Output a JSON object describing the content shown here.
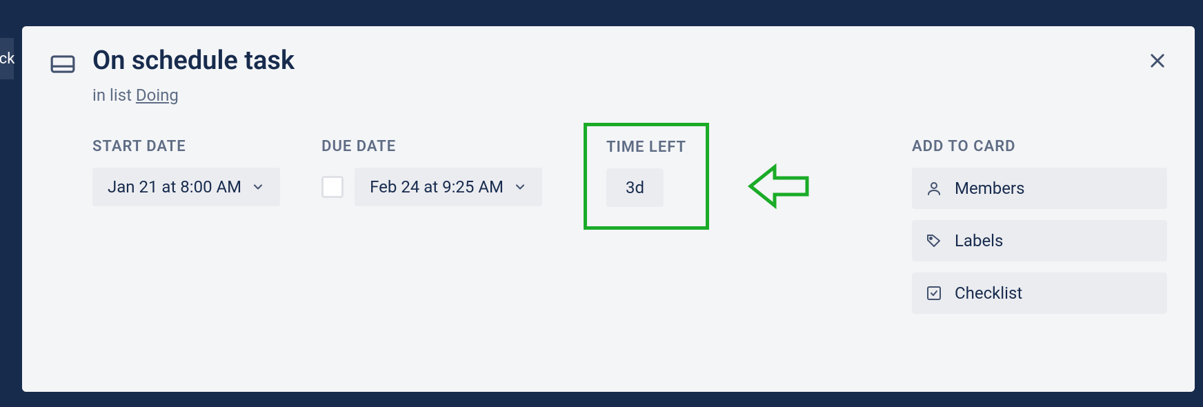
{
  "bg_hint": "ck",
  "card": {
    "title": "On schedule task",
    "subtitle_prefix": "in list ",
    "list_name": "Doing"
  },
  "fields": {
    "start_date": {
      "label": "Start date",
      "value": "Jan 21 at 8:00 AM"
    },
    "due_date": {
      "label": "Due date",
      "value": "Feb 24 at 9:25 AM"
    },
    "time_left": {
      "label": "Time left",
      "value": "3d"
    }
  },
  "sidebar": {
    "heading": "Add to card",
    "items": [
      {
        "label": "Members"
      },
      {
        "label": "Labels"
      },
      {
        "label": "Checklist"
      }
    ]
  },
  "annotation": {
    "color": "#1aab27"
  }
}
